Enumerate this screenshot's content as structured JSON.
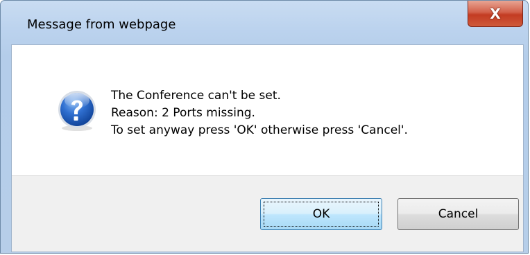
{
  "window": {
    "title": "Message from webpage",
    "close_label": "X"
  },
  "message": {
    "icon": "question-icon",
    "lines": [
      "The Conference can't be set.",
      "Reason: 2 Ports missing.",
      "To set anyway press 'OK' otherwise press 'Cancel'."
    ]
  },
  "buttons": {
    "ok_label": "OK",
    "cancel_label": "Cancel",
    "default": "OK"
  },
  "colors": {
    "frame": "#b9d1ea",
    "close_button": "#c7452c",
    "icon_blue": "#1f5fb8",
    "button_bar": "#f0f0f0"
  }
}
